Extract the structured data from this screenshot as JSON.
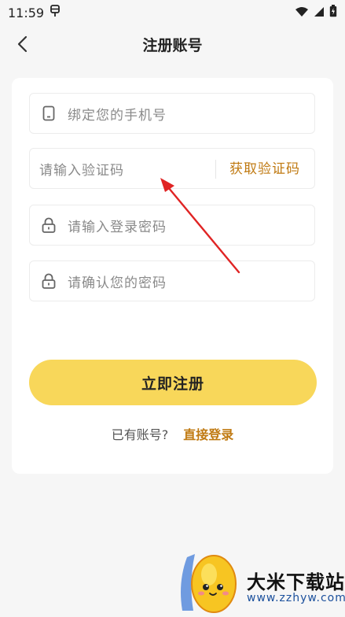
{
  "statusbar": {
    "time": "11:59",
    "icons": [
      "notification-icon",
      "wifi-icon",
      "signal-icon",
      "battery-icon"
    ]
  },
  "header": {
    "title": "注册账号",
    "back_icon": "chevron-left-icon"
  },
  "form": {
    "phone_placeholder": "绑定您的手机号",
    "code_placeholder": "请输入验证码",
    "get_code_label": "获取验证码",
    "password_placeholder": "请输入登录密码",
    "confirm_placeholder": "请确认您的密码",
    "submit_label": "立即注册"
  },
  "login": {
    "question": "已有账号?",
    "link_label": "直接登录"
  },
  "watermark": {
    "title": "大米下载站",
    "url": "www.zzhyw.com"
  },
  "colors": {
    "accent": "#c07a12",
    "button": "#f8d75a",
    "arrow": "#e02424",
    "background": "#f6f6f6"
  }
}
